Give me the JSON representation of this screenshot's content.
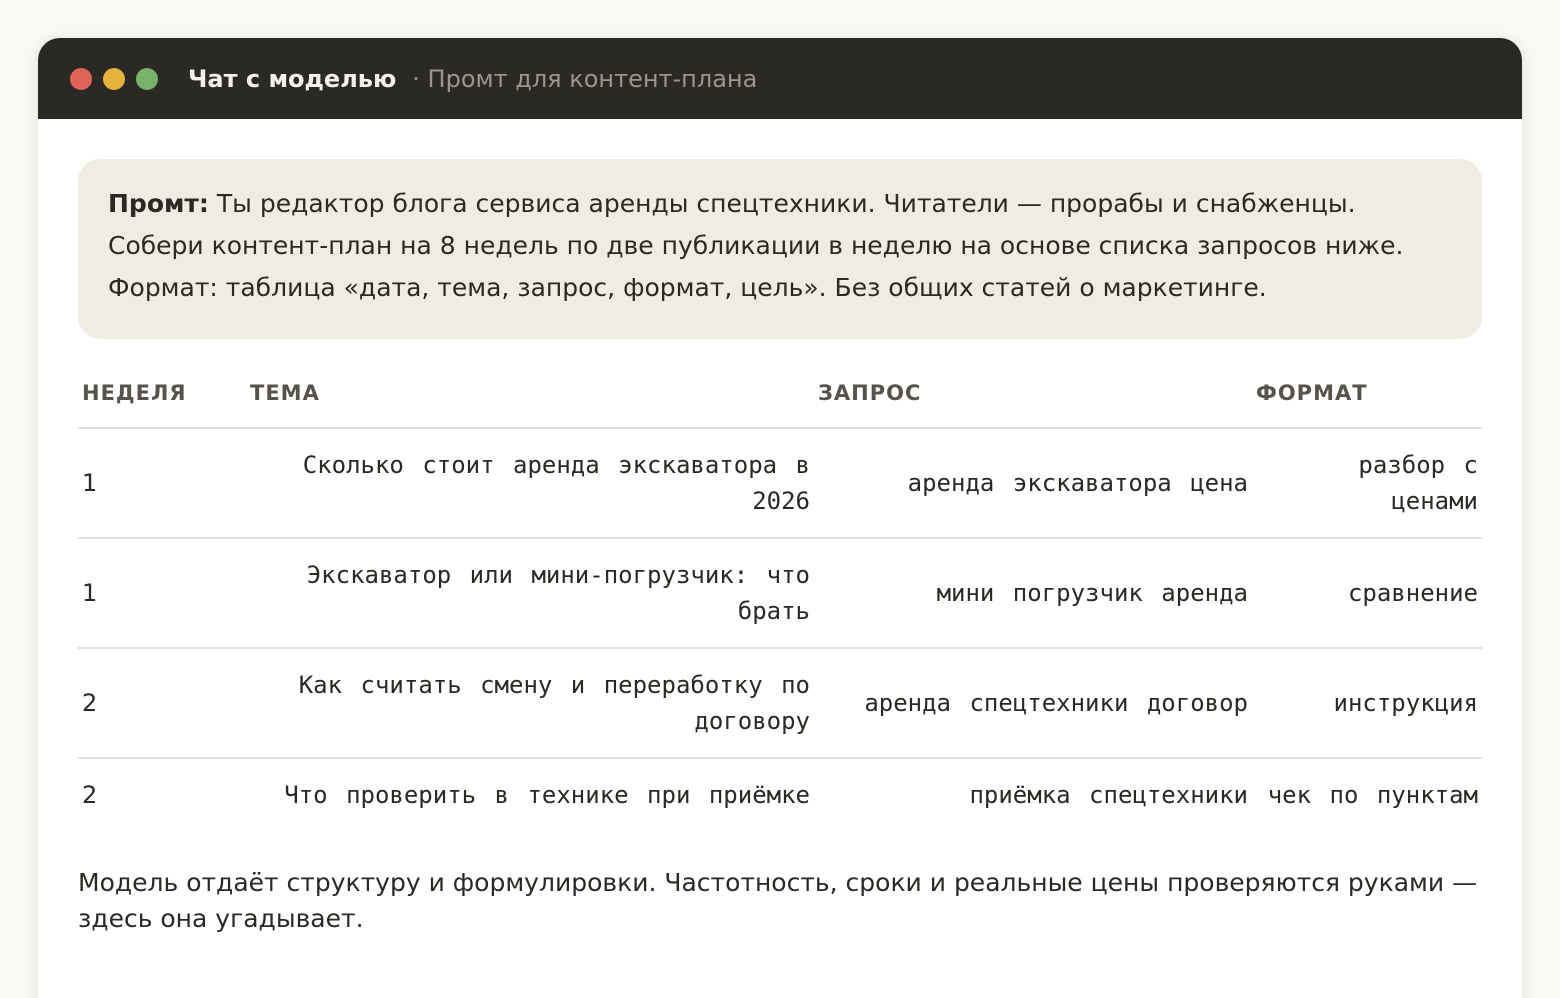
{
  "window": {
    "title": "Чат с моделью",
    "subtitle": "· Промт для контент‑плана"
  },
  "prompt": {
    "label": "Промт:",
    "text": "Ты редактор блога сервиса аренды спецтехники. Читатели — прорабы и снабженцы. Собери контент‑план на 8 недель по две публикации в неделю на основе списка запросов ниже. Формат: таблица «дата, тема, запрос, формат, цель». Без общих статей о маркетинге."
  },
  "table": {
    "headers": {
      "week": "НЕДЕЛЯ",
      "topic": "ТЕМА",
      "query": "ЗАПРОС",
      "format": "ФОРМАТ"
    },
    "rows": [
      {
        "week": "1",
        "topic": "Сколько стоит аренда экскаватора в 2026",
        "query": "аренда экскаватора цена",
        "format": "разбор с ценами"
      },
      {
        "week": "1",
        "topic": "Экскаватор или мини-погрузчик: что брать",
        "query": "мини погрузчик аренда",
        "format": "сравнение"
      },
      {
        "week": "2",
        "topic": "Как считать смену и переработку по договору",
        "query": "аренда спецтехники договор",
        "format": "инструкция"
      },
      {
        "week": "2",
        "topic": "Что проверить в технике при приёмке",
        "query": "приёмка спецтехники",
        "format": "чек по пунктам"
      }
    ]
  },
  "footer_note": "Модель отдаёт структуру и формулировки. Частотность, сроки и реальные цены проверяются руками — здесь она угадывает."
}
